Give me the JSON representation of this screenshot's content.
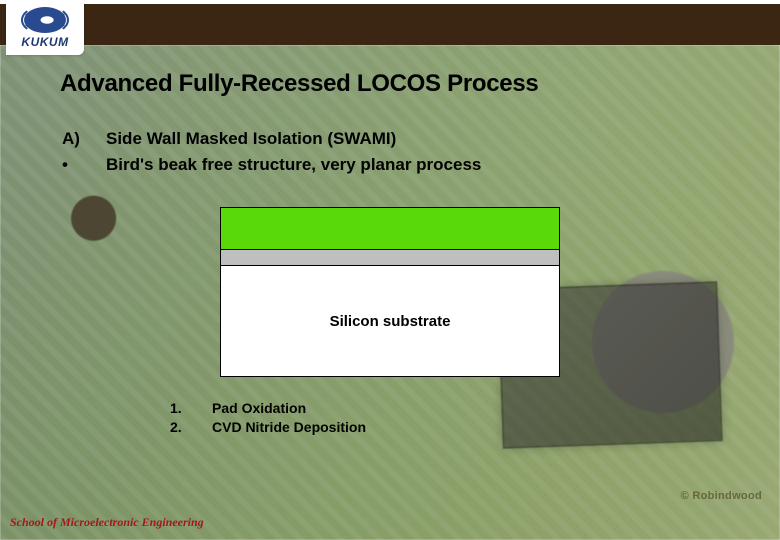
{
  "header": {
    "logo_text": "KUKUM"
  },
  "title": "Advanced Fully-Recessed LOCOS Process",
  "bullets": [
    {
      "marker": "A)",
      "text": "Side Wall Masked Isolation (SWAMI)"
    },
    {
      "marker": "•",
      "text": "Bird's beak free structure, very planar process"
    }
  ],
  "diagram": {
    "layers": {
      "top_color": "#59d90a",
      "mid_color": "#bfbfbf",
      "body_color": "#ffffff"
    },
    "substrate_label": "Silicon substrate"
  },
  "steps": [
    {
      "num": "1.",
      "text": "Pad Oxidation"
    },
    {
      "num": "2.",
      "text": "CVD Nitride Deposition"
    }
  ],
  "watermark": "© Robindwood",
  "footer": "School of Microelectronic Engineering"
}
